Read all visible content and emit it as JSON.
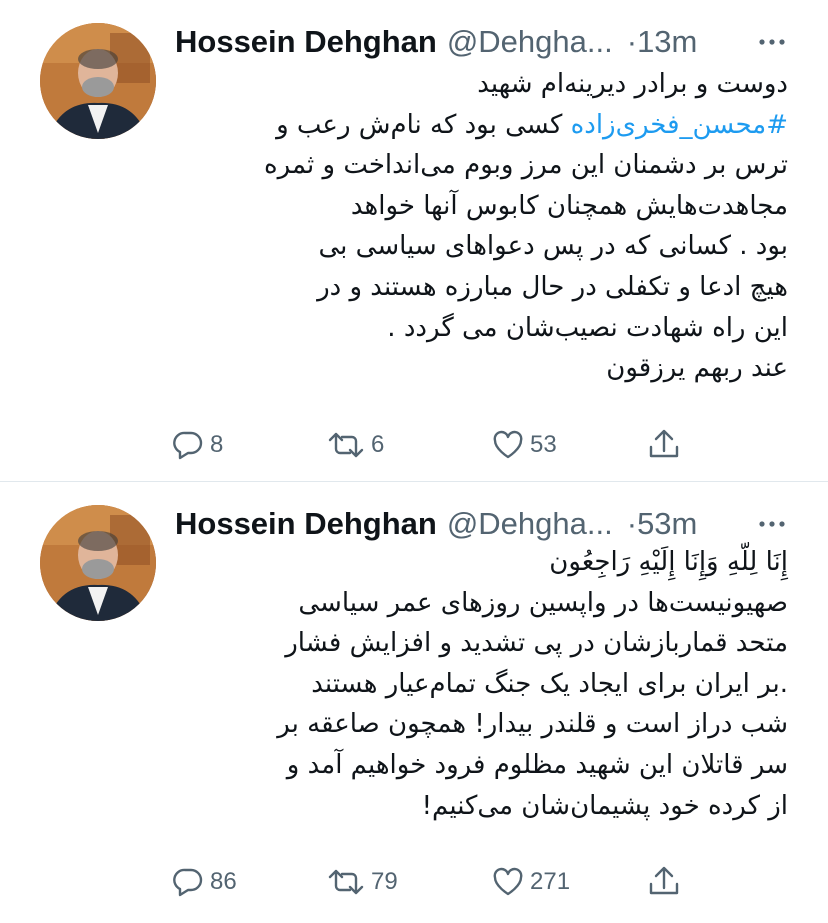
{
  "tweets": [
    {
      "author": {
        "name": "Hossein Dehghan",
        "handle": "@Dehgha...",
        "avatar": "profile-photo"
      },
      "separator": "·",
      "time": "13m",
      "lines": [
        "دوست و برادر دیرینه‌ام شهید",
        "کسی بود که نام‌ش رعب و",
        "ترس بر دشمنان این مرز وبوم می‌انداخت و ثمره",
        "مجاهدت‌هایش همچنان کابوس آنها خواهد",
        "بود . کسانی که در پس دعواهای سیاسی بی",
        "هیچ ادعا و تکفلی در حال مبارزه هستند و در",
        " این راه شهادت نصیب‌شان می گردد .",
        "عند ربهم یرزقون"
      ],
      "hashtag": "#محسن_فخری‌زاده",
      "counts": {
        "replies": "8",
        "retweets": "6",
        "likes": "53"
      }
    },
    {
      "author": {
        "name": "Hossein Dehghan",
        "handle": "@Dehgha...",
        "avatar": "profile-photo"
      },
      "separator": "·",
      "time": "53m",
      "lines": [
        "إِنَا لِلّهِ وَإِنَا إِلَيْهِ رَاجِعُون",
        "صهیونیست‌ها در واپسین روزهای عمر سیاسی",
        "متحد قماربازشان در پی تشدید و افزایش فشار",
        ".بر ایران برای ایجاد یک جنگ تمام‌عیار هستند",
        "شب دراز است و قلندر بیدار! همچون صاعقه بر",
        "سر قاتلان این شهید مظلوم فرود خواهیم آمد و",
        "از کرده خود پشیمان‌شان می‌کنیم!"
      ],
      "counts": {
        "replies": "86",
        "retweets": "79",
        "likes": "271"
      }
    }
  ],
  "icons": {
    "more": "more-icon",
    "reply": "reply-icon",
    "retweet": "retweet-icon",
    "like": "heart-icon",
    "share": "share-icon"
  },
  "colors": {
    "text": "#0f1419",
    "secondary": "#536471",
    "hashtag": "#1d9bf0",
    "divider": "#e1e8ed"
  }
}
